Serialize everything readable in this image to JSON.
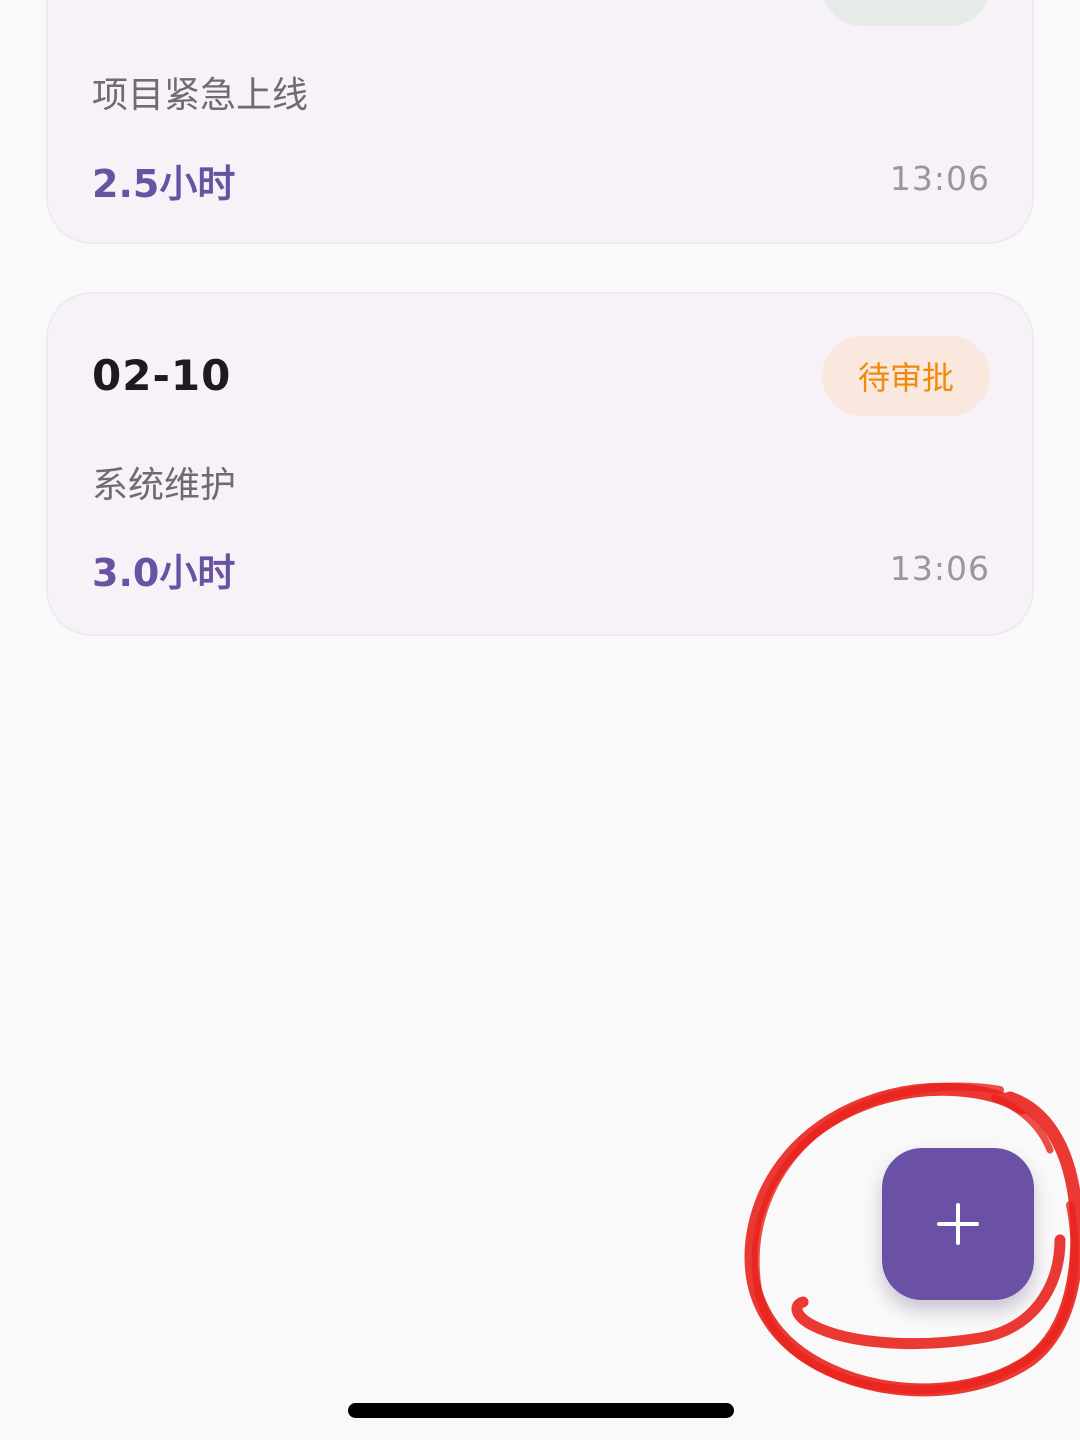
{
  "records": [
    {
      "date": "",
      "status": "",
      "status_color": "#2e7d32",
      "status_bg": "#e7ebe8",
      "reason": "项目紧急上线",
      "hours": "2.5小时",
      "time": "13:06"
    },
    {
      "date": "02-10",
      "status": "待审批",
      "status_color": "#f08a0c",
      "status_bg": "#fae7de",
      "reason": "系统维护",
      "hours": "3.0小时",
      "time": "13:06"
    }
  ],
  "fab": {
    "icon": "plus-icon",
    "color": "#6a51a6"
  },
  "annotation": {
    "shape": "circle",
    "color": "#e8231c"
  },
  "colors": {
    "background": "#f9f9f9",
    "card": "#f6f2f8",
    "accent": "#6a52a2"
  }
}
